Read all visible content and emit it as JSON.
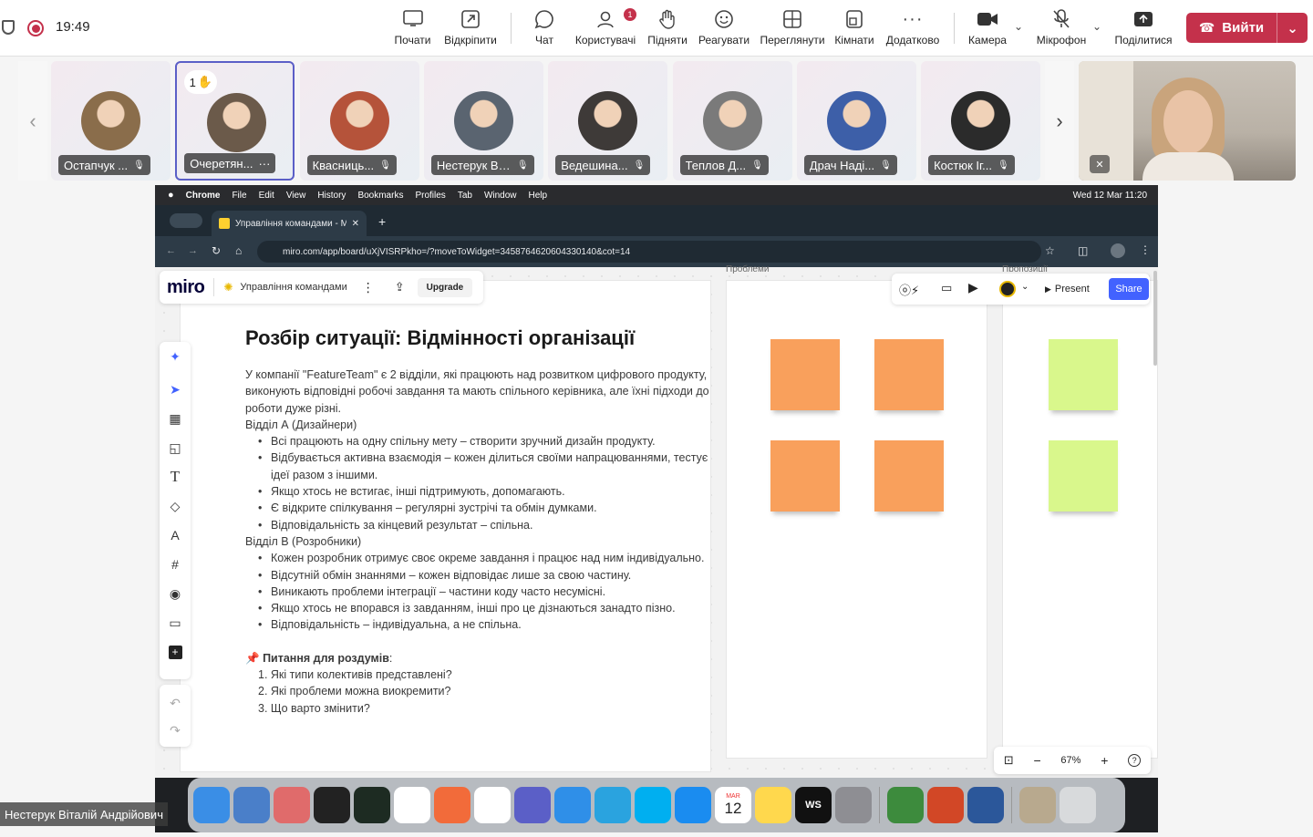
{
  "status": {
    "time": "19:49"
  },
  "toolbar": {
    "start": "Почати",
    "popout": "Відкріпити",
    "chat": "Чат",
    "people": "Користувачі",
    "people_badge": "1",
    "raise": "Підняти",
    "react": "Реагувати",
    "view": "Переглянути",
    "rooms": "Кімнати",
    "more": "Додатково",
    "camera": "Камера",
    "mic": "Мікрофон",
    "share": "Поділитися",
    "leave": "Вийти"
  },
  "participants": [
    {
      "name": "Остапчук ...",
      "color": "#8a6d4b"
    },
    {
      "name": "Очеретян...",
      "color": "#6b5a4a",
      "hand": "1",
      "active": true
    },
    {
      "name": "Квасниць...",
      "color": "#b5533a"
    },
    {
      "name": "Нестерук Віта...",
      "color": "#5a6470"
    },
    {
      "name": "Ведешина...",
      "color": "#3e3a38"
    },
    {
      "name": "Теплов Д...",
      "color": "#7a7a7a"
    },
    {
      "name": "Драч Наді...",
      "color": "#3d5fa8"
    },
    {
      "name": "Костюк Іг...",
      "color": "#2b2b2b"
    }
  ],
  "presenter_label": "Нестерук Віталій Андрійович",
  "mac": {
    "menu": [
      "Chrome",
      "File",
      "Edit",
      "View",
      "History",
      "Bookmarks",
      "Profiles",
      "Tab",
      "Window",
      "Help"
    ],
    "clock": "Wed 12 Mar  11:20"
  },
  "browser": {
    "tab_title": "Управління командами - Mi",
    "url": "miro.com/app/board/uXjVISRPkho=/?moveToWidget=3458764620604330140&cot=14"
  },
  "miro": {
    "logo": "miro",
    "board_name": "Управління командами",
    "upgrade": "Upgrade",
    "present": "Present",
    "share": "Share",
    "zoom": "67%",
    "frame_problems": "Проблеми",
    "frame_proposals": "Пропозиції"
  },
  "doc": {
    "title": "Розбір ситуації: Відмінності організації",
    "intro": "У компанії \"FeatureTeam\" є 2 відділи, які працюють над розвитком цифрового продукту, виконують відповідні робочі завдання та мають спільного керівника, але їхні підходи до роботи дуже різні.",
    "deptA": "Відділ А (Дизайнери)",
    "deptA_items": [
      "Всі працюють на одну спільну мету – створити зручний дизайн продукту.",
      "Відбувається активна взаємодія – кожен ділиться своїми напрацюваннями, тестує ідеї разом з іншими.",
      "Якщо хтось не встигає, інші підтримують, допомагають.",
      "Є відкрите спілкування – регулярні зустрічі та обмін думками.",
      "Відповідальність за кінцевий результат – спільна."
    ],
    "deptB": "Відділ В (Розробники)",
    "deptB_items": [
      "Кожен розробник отримує своє окреме завдання і працює над ним індивідуально.",
      "Відсутній обмін знаннями – кожен відповідає лише за свою частину.",
      "Виникають проблеми інтеграції – частини коду часто несумісні.",
      "Якщо хтось не впорався із завданням, інші про це дізнаються занадто пізно.",
      "Відповідальність – індивідуальна, а не спільна."
    ],
    "questions_title": "Питання для роздумів",
    "questions": [
      "1. Які типи колективів представлені?",
      "2. Які проблеми можна виокремити?",
      "3. Що варто змінити?"
    ]
  },
  "dock_apps": [
    {
      "name": "Finder",
      "color": "#3a8ee6"
    },
    {
      "name": "Preview",
      "color": "#4a7fc9"
    },
    {
      "name": "Launchpad",
      "color": "#e06b6b"
    },
    {
      "name": "Terminal",
      "color": "#222222"
    },
    {
      "name": "Activity",
      "color": "#1d2b22"
    },
    {
      "name": "ChatGPT",
      "color": "#ffffff"
    },
    {
      "name": "Pen",
      "color": "#f26b3a"
    },
    {
      "name": "Chrome",
      "color": "#ffffff"
    },
    {
      "name": "Teams",
      "color": "#5b5fc7"
    },
    {
      "name": "Safari",
      "color": "#2f8fe8"
    },
    {
      "name": "Telegram",
      "color": "#2aa3df"
    },
    {
      "name": "Skype",
      "color": "#00aff0"
    },
    {
      "name": "AppStore",
      "color": "#1a8cf0"
    },
    {
      "name": "Calendar",
      "color": "#ffffff",
      "text": "12",
      "month": "MAR"
    },
    {
      "name": "Notes",
      "color": "#ffd84d"
    },
    {
      "name": "WebStorm",
      "color": "#111111",
      "text": "WS"
    },
    {
      "name": "Settings",
      "color": "#8e8e93"
    },
    {
      "name": "Cursor",
      "color": "#3d8b3d"
    },
    {
      "name": "PowerPoint",
      "color": "#d24726"
    },
    {
      "name": "Word",
      "color": "#2b579a"
    },
    {
      "name": "Image",
      "color": "#b8a98e"
    },
    {
      "name": "Trash",
      "color": "#d8dadc"
    }
  ]
}
